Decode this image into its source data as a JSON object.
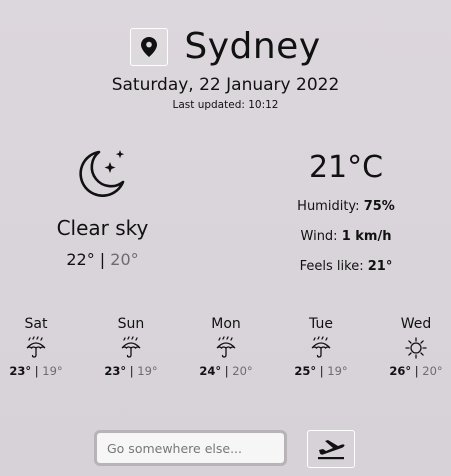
{
  "header": {
    "city": "Sydney",
    "date": "Saturday, 22 January 2022",
    "last_updated": "Last updated: 10:12",
    "location_icon": "map-pin-icon"
  },
  "current": {
    "icon": "moon-stars-icon",
    "description": "Clear sky",
    "high": "22°",
    "low": "20°",
    "temperature": "21°C",
    "humidity_label": "Humidity:",
    "humidity_value": "75%",
    "wind_label": "Wind:",
    "wind_value": "1 km/h",
    "feels_label": "Feels like:",
    "feels_value": "21°"
  },
  "forecast": [
    {
      "day": "Sat",
      "icon": "rain-umbrella-icon",
      "high": "23°",
      "low": "19°"
    },
    {
      "day": "Sun",
      "icon": "rain-umbrella-icon",
      "high": "23°",
      "low": "19°"
    },
    {
      "day": "Mon",
      "icon": "rain-umbrella-icon",
      "high": "24°",
      "low": "20°"
    },
    {
      "day": "Tue",
      "icon": "rain-umbrella-icon",
      "high": "25°",
      "low": "19°"
    },
    {
      "day": "Wed",
      "icon": "sun-icon",
      "high": "26°",
      "low": "20°"
    }
  ],
  "search": {
    "placeholder": "Go somewhere else...",
    "go_icon": "plane-takeoff-icon"
  },
  "colors": {
    "background": "#dad5da",
    "text": "#111111",
    "muted": "#6e6a6e"
  }
}
